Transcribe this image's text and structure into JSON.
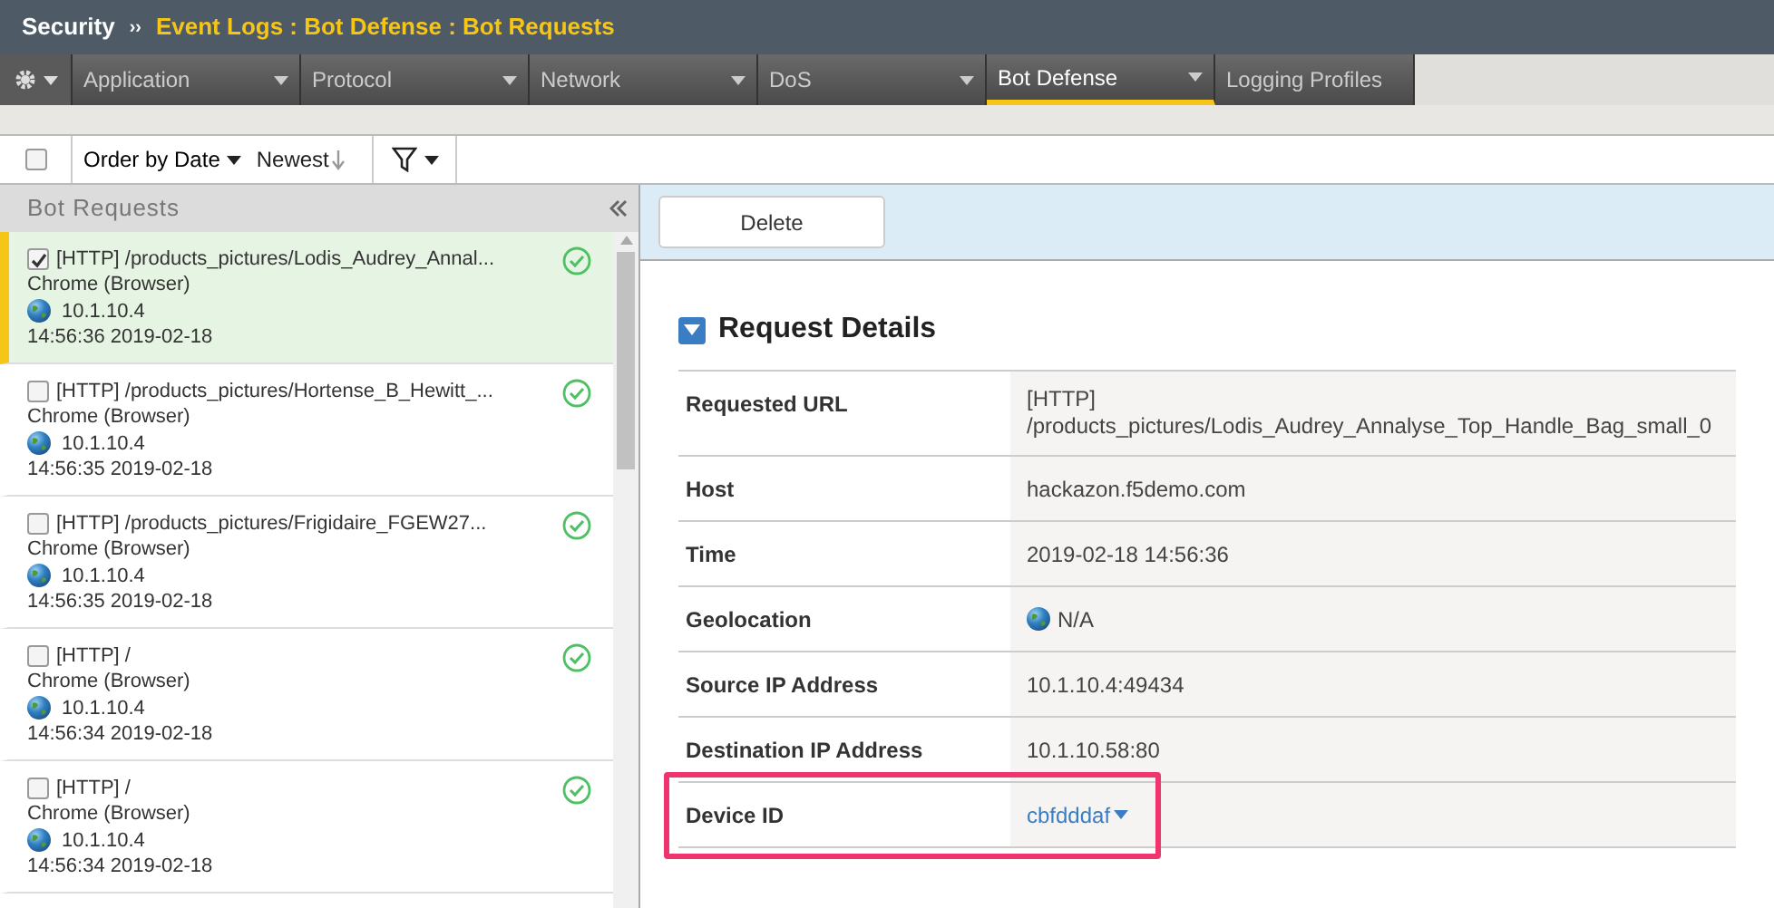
{
  "breadcrumb": {
    "root": "Security",
    "separator": "››",
    "path": "Event Logs : Bot Defense : Bot Requests"
  },
  "tabs": [
    {
      "label": "Application",
      "selected": false,
      "dropdown": true
    },
    {
      "label": "Protocol",
      "selected": false,
      "dropdown": true
    },
    {
      "label": "Network",
      "selected": false,
      "dropdown": true
    },
    {
      "label": "DoS",
      "selected": false,
      "dropdown": true
    },
    {
      "label": "Bot Defense",
      "selected": true,
      "dropdown": true
    },
    {
      "label": "Logging Profiles",
      "selected": false,
      "dropdown": false
    }
  ],
  "toolbar": {
    "select_all_checked": false,
    "order": "Order by Date",
    "direction": "Newest"
  },
  "list": {
    "title": "Bot Requests",
    "items": [
      {
        "request": "[HTTP] /products_pictures/Lodis_Audrey_Annal...",
        "client": "Chrome (Browser)",
        "ip": "10.1.10.4",
        "time": "14:56:36 2019-02-18",
        "checked": true,
        "selected": true
      },
      {
        "request": "[HTTP] /products_pictures/Hortense_B_Hewitt_...",
        "client": "Chrome (Browser)",
        "ip": "10.1.10.4",
        "time": "14:56:35 2019-02-18",
        "checked": false,
        "selected": false
      },
      {
        "request": "[HTTP] /products_pictures/Frigidaire_FGEW27...",
        "client": "Chrome (Browser)",
        "ip": "10.1.10.4",
        "time": "14:56:35 2019-02-18",
        "checked": false,
        "selected": false
      },
      {
        "request": "[HTTP] /",
        "client": "Chrome (Browser)",
        "ip": "10.1.10.4",
        "time": "14:56:34 2019-02-18",
        "checked": false,
        "selected": false
      },
      {
        "request": "[HTTP] /",
        "client": "Chrome (Browser)",
        "ip": "10.1.10.4",
        "time": "14:56:34 2019-02-18",
        "checked": false,
        "selected": false
      }
    ]
  },
  "actions": [
    "Delete"
  ],
  "details": {
    "title": "Request Details",
    "expanded": true,
    "rows": [
      {
        "label": "Requested URL",
        "kind": "lines",
        "lines": [
          "[HTTP]",
          "/products_pictures/Lodis_Audrey_Annalyse_Top_Handle_Bag_small_0"
        ],
        "highlighted": false
      },
      {
        "label": "Host",
        "kind": "text",
        "value": "hackazon.f5demo.com",
        "highlighted": false
      },
      {
        "label": "Time",
        "kind": "text",
        "value": "2019-02-18 14:56:36",
        "highlighted": false
      },
      {
        "label": "Geolocation",
        "kind": "geo",
        "value": "N/A",
        "highlighted": false
      },
      {
        "label": "Source IP Address",
        "kind": "text",
        "value": "10.1.10.4:49434",
        "highlighted": false
      },
      {
        "label": "Destination IP Address",
        "kind": "text",
        "value": "10.1.10.58:80",
        "highlighted": false
      },
      {
        "label": "Device ID",
        "kind": "link",
        "value": "cbfdddaf",
        "highlighted": true
      }
    ]
  }
}
